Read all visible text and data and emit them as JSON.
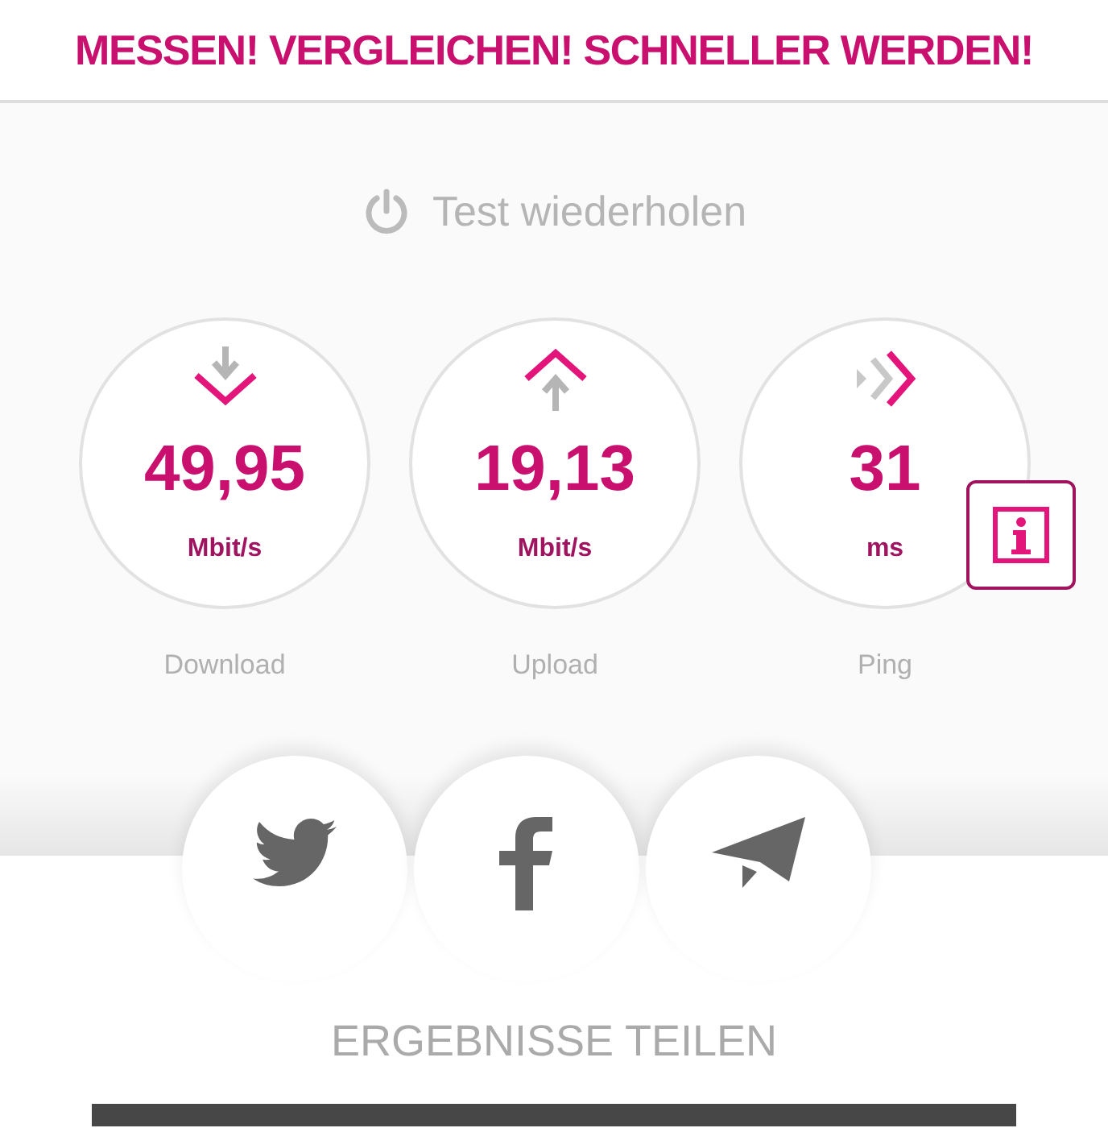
{
  "header": {
    "title": "MESSEN! VERGLEICHEN! SCHNELLER WERDEN!"
  },
  "retest": {
    "label": "Test wiederholen"
  },
  "metrics": [
    {
      "kind": "download",
      "value": "49,95",
      "unit": "Mbit/s",
      "label": "Download"
    },
    {
      "kind": "upload",
      "value": "19,13",
      "unit": "Mbit/s",
      "label": "Upload"
    },
    {
      "kind": "ping",
      "value": "31",
      "unit": "ms",
      "label": "Ping"
    }
  ],
  "share": {
    "targets": [
      {
        "kind": "twitter"
      },
      {
        "kind": "facebook"
      },
      {
        "kind": "message"
      }
    ],
    "label": "ERGEBNISSE TEILEN"
  }
}
